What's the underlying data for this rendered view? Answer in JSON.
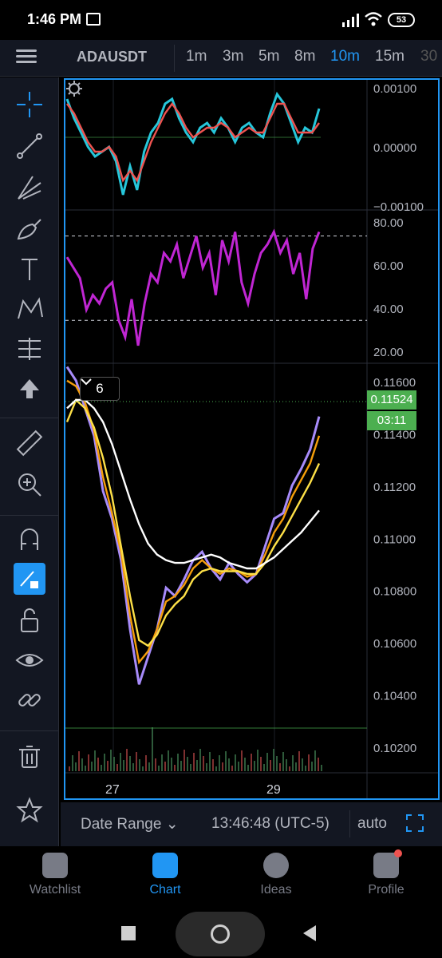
{
  "status_bar": {
    "time": "1:46 PM",
    "battery": "53"
  },
  "top_bar": {
    "symbol": "ADAUSDT",
    "intervals": [
      {
        "label": "1m",
        "active": false
      },
      {
        "label": "3m",
        "active": false
      },
      {
        "label": "5m",
        "active": false
      },
      {
        "label": "8m",
        "active": false
      },
      {
        "label": "10m",
        "active": true
      },
      {
        "label": "15m",
        "active": false
      },
      {
        "label": "30",
        "active": false
      }
    ]
  },
  "sidebar_tools": [
    "crosshair-icon",
    "trend-line-icon",
    "pitchfork-icon",
    "brush-icon",
    "text-icon",
    "pattern-icon",
    "fib-icon",
    "arrow-up-icon",
    "ruler-icon",
    "zoom-in-icon",
    "magnet-icon",
    "lock-drawing-icon",
    "unlock-icon",
    "eye-icon",
    "link-icon",
    "trash-icon",
    "star-icon"
  ],
  "chart_data": [
    {
      "type": "line",
      "pane": "macd",
      "ylim": [
        -0.0015,
        0.0012
      ],
      "tick_labels": [
        "0.00100",
        "0.00000",
        "−0.00100"
      ],
      "series": [
        {
          "color": "#26c6da",
          "values": [
            0.0008,
            0.0004,
            0.0001,
            -0.0002,
            -0.0004,
            -0.0003,
            -0.0002,
            -0.0005,
            -0.0012,
            -0.0006,
            -0.0011,
            -0.0003,
            0.0001,
            0.0003,
            0.0007,
            0.0008,
            0.0004,
            0.0001,
            -0.0001,
            0.0002,
            0.0003,
            0.0001,
            0.0004,
            0.0002,
            -0.0001,
            0.0002,
            0.0003,
            0.0001,
            0.0,
            0.0005,
            0.0009,
            0.0007,
            0.0003,
            -0.0001,
            0.0002,
            0.0001,
            0.0006
          ]
        },
        {
          "color": "#ef5350",
          "values": [
            0.0007,
            0.0005,
            0.0002,
            -0.0001,
            -0.0003,
            -0.0003,
            -0.0002,
            -0.0004,
            -0.0009,
            -0.0007,
            -0.0009,
            -0.0005,
            -0.0001,
            0.0002,
            0.0005,
            0.0007,
            0.0005,
            0.0002,
            0.0,
            0.0001,
            0.0002,
            0.0002,
            0.0003,
            0.0002,
            0.0,
            0.0001,
            0.0002,
            0.0001,
            0.0001,
            0.0004,
            0.0007,
            0.0007,
            0.0004,
            0.0001,
            0.0001,
            0.0001,
            0.0003
          ]
        }
      ]
    },
    {
      "type": "line",
      "pane": "rsi",
      "ylim": [
        10,
        82
      ],
      "tick_labels": [
        "80.00",
        "60.00",
        "40.00",
        "20.00"
      ],
      "levels": [
        70,
        30
      ],
      "series": [
        {
          "color": "#c026d3",
          "values": [
            60,
            55,
            50,
            35,
            42,
            38,
            45,
            48,
            30,
            22,
            40,
            18,
            38,
            52,
            48,
            62,
            58,
            66,
            50,
            60,
            70,
            55,
            62,
            42,
            68,
            58,
            72,
            48,
            38,
            52,
            62,
            66,
            72,
            62,
            68,
            52,
            62,
            40,
            64,
            72
          ]
        }
      ]
    },
    {
      "type": "line",
      "pane": "price",
      "ylim": [
        0.1018,
        0.1166
      ],
      "tick_labels": [
        "0.11600",
        "0.11400",
        "0.11200",
        "0.11000",
        "0.10800",
        "0.10600",
        "0.10400",
        "0.10200"
      ],
      "x_tick_labels": [
        "27",
        "29"
      ],
      "last_price": "0.11524",
      "countdown": "03:11",
      "alert_count": "6",
      "series": [
        {
          "color": "#a78bfa",
          "values": [
            0.1165,
            0.116,
            0.115,
            0.114,
            0.112,
            0.111,
            0.1095,
            0.107,
            0.105,
            0.106,
            0.107,
            0.1085,
            0.1082,
            0.1088,
            0.1095,
            0.1098,
            0.1092,
            0.1088,
            0.1094,
            0.109,
            0.1087,
            0.109,
            0.11,
            0.111,
            0.1112,
            0.1122,
            0.1128,
            0.1135,
            0.1147
          ]
        },
        {
          "color": "#f59e0b",
          "values": [
            0.116,
            0.1158,
            0.1152,
            0.1142,
            0.1125,
            0.1112,
            0.1098,
            0.1075,
            0.1058,
            0.1062,
            0.107,
            0.108,
            0.1082,
            0.1086,
            0.1092,
            0.1095,
            0.1092,
            0.109,
            0.1092,
            0.1091,
            0.1089,
            0.109,
            0.1097,
            0.1105,
            0.111,
            0.1118,
            0.1124,
            0.113,
            0.114
          ]
        },
        {
          "color": "#fde047",
          "values": [
            0.1145,
            0.1153,
            0.115,
            0.1143,
            0.1132,
            0.1118,
            0.11,
            0.1082,
            0.1066,
            0.1064,
            0.1068,
            0.1075,
            0.1079,
            0.1082,
            0.1088,
            0.1091,
            0.1092,
            0.1091,
            0.1091,
            0.1091,
            0.109,
            0.109,
            0.1094,
            0.11,
            0.1105,
            0.1111,
            0.1117,
            0.1123,
            0.113
          ]
        },
        {
          "color": "#ffffff",
          "values": [
            0.115,
            0.1153,
            0.1153,
            0.115,
            0.1145,
            0.1137,
            0.1127,
            0.1117,
            0.1108,
            0.1101,
            0.1097,
            0.1095,
            0.1094,
            0.1094,
            0.1095,
            0.1096,
            0.1097,
            0.1096,
            0.1094,
            0.1093,
            0.1092,
            0.1092,
            0.1094,
            0.1096,
            0.1099,
            0.1102,
            0.1105,
            0.1109,
            0.1113
          ]
        }
      ]
    }
  ],
  "bottom_bar": {
    "date_range": "Date Range",
    "clock": "13:46:48 (UTC-5)",
    "scale": "auto"
  },
  "nav": [
    {
      "label": "Watchlist",
      "active": false
    },
    {
      "label": "Chart",
      "active": true
    },
    {
      "label": "Ideas",
      "active": false
    },
    {
      "label": "Profile",
      "active": false
    }
  ]
}
